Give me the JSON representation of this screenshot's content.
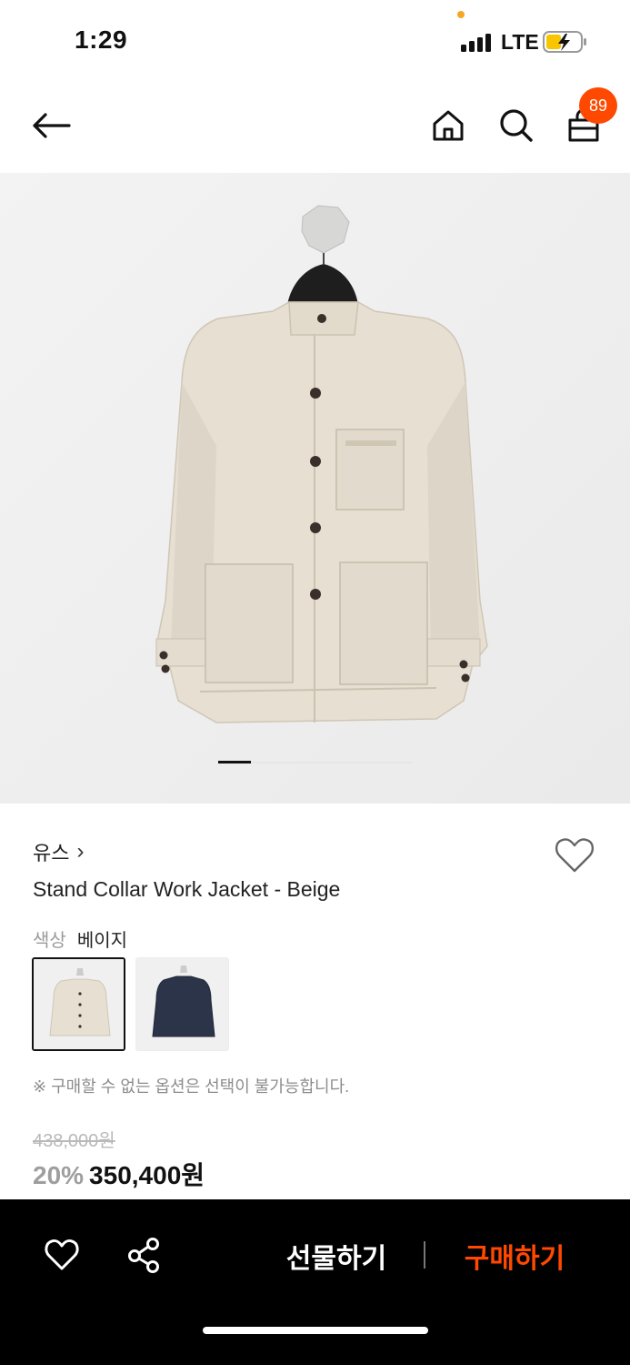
{
  "status_bar": {
    "time": "1:29",
    "network": "LTE"
  },
  "header": {
    "back_icon": "arrow-left-icon",
    "home_icon": "home-icon",
    "search_icon": "search-icon",
    "cart_icon": "shopping-bag-icon",
    "cart_count": "89",
    "badge_color": "#ff4800"
  },
  "gallery": {
    "image_subject": "beige-jacket-photo",
    "current_index": 1
  },
  "product": {
    "brand": "유스",
    "brand_chevron": "›",
    "title": "Stand Collar Work Jacket - Beige",
    "color_label": "색상",
    "color_value": "베이지",
    "swatches": [
      {
        "name": "beige",
        "color": "#e9e2d6",
        "selected": true
      },
      {
        "name": "navy",
        "color": "#2b3448",
        "selected": false
      }
    ],
    "option_note": "※ 구매할 수 없는 옵션은 선택이 불가능합니다.",
    "original_price": "438,000원",
    "discount": "20%",
    "sale_price": "350,400원"
  },
  "bottom_bar": {
    "like_icon": "heart-icon",
    "share_icon": "share-icon",
    "gift_label": "선물하기",
    "buy_label": "구매하기",
    "accent": "#ff4800"
  }
}
